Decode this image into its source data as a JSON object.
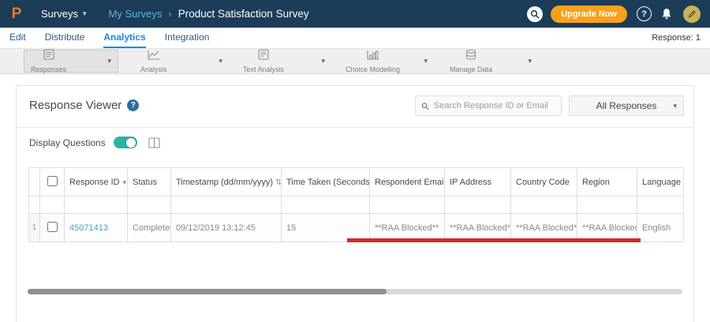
{
  "colors": {
    "topbar_bg": "#1d3c58",
    "breadcrumb_teal": "#57b8dc",
    "active_tab_blue": "#1b87e6",
    "upgrade_orange": "#f7a11c",
    "toggle_teal": "#2bb3a3",
    "annotation_red": "#d62a1f",
    "link_teal": "#4aa3c9"
  },
  "topbar": {
    "logo_letter": "P",
    "product_menu_label": "Surveys",
    "breadcrumb": {
      "parent": "My Surveys",
      "separator": "›",
      "current": "Product Satisfaction Survey"
    },
    "upgrade_button": "Upgrade Now",
    "help_button": "?"
  },
  "nav": {
    "tabs": [
      {
        "label": "Edit",
        "active": false
      },
      {
        "label": "Distribute",
        "active": false
      },
      {
        "label": "Analytics",
        "active": true
      },
      {
        "label": "Integration",
        "active": false
      }
    ],
    "response_count": "Response: 1"
  },
  "toolbar": {
    "items": [
      {
        "label": "Responses",
        "icon": "responses-icon",
        "active": true
      },
      {
        "label": "Analysis",
        "icon": "analysis-icon",
        "active": false
      },
      {
        "label": "Text Analysis",
        "icon": "text-analysis-icon",
        "active": false
      },
      {
        "label": "Choice Modelling",
        "icon": "choice-modelling-icon",
        "active": false
      },
      {
        "label": "Manage Data",
        "icon": "manage-data-icon",
        "active": false
      }
    ]
  },
  "viewer": {
    "title": "Response Viewer",
    "help_icon": "?",
    "search_placeholder": "Search Response ID or Email",
    "filter_selected": "All Responses",
    "display_questions_label": "Display Questions",
    "display_questions_on": true
  },
  "table": {
    "columns": [
      "Response ID",
      "Status",
      "Timestamp (dd/mm/yyyy)",
      "Time Taken (Seconds)",
      "Respondent Email",
      "IP Address",
      "Country Code",
      "Region",
      "Language"
    ],
    "sort": {
      "column": "Response ID",
      "direction": "desc"
    },
    "rows": [
      {
        "index": "1",
        "response_id": "45071413",
        "status": "Completed",
        "timestamp": "09/12/2019 13:12:45",
        "time_taken": "15",
        "respondent_email": "**RAA Blocked**",
        "ip_address": "**RAA Blocked**",
        "country_code": "**RAA Blocked**",
        "region": "**RAA Blocked**",
        "language": "English"
      }
    ]
  }
}
